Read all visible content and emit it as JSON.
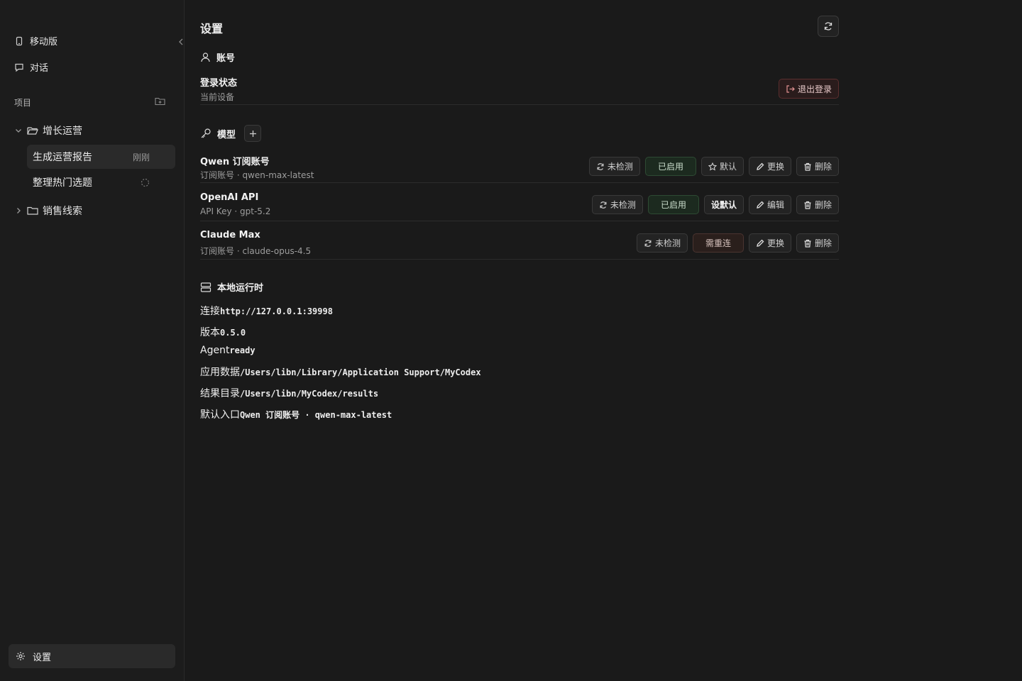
{
  "sidebar": {
    "nav": [
      {
        "label": "移动版",
        "icon": "phone-icon"
      },
      {
        "label": "对话",
        "icon": "chat-icon"
      }
    ],
    "section_label": "项目",
    "projects": [
      {
        "name": "增长运营",
        "expanded": true,
        "threads": [
          {
            "title": "生成运营报告",
            "meta": "刚刚",
            "active": true
          },
          {
            "title": "整理热门选题",
            "meta": "",
            "loading": true
          }
        ]
      },
      {
        "name": "销售线索",
        "expanded": false,
        "threads": []
      }
    ],
    "settings_label": "设置"
  },
  "main": {
    "title": "设置",
    "account": {
      "heading": "账号",
      "login_label": "登录状态",
      "login_sub": "当前设备",
      "logout_label": "退出登录"
    },
    "models": {
      "heading": "模型",
      "items": [
        {
          "name": "Qwen 订阅账号",
          "sub": "订阅账号 · qwen-max-latest",
          "check": "未检测",
          "status": "已启用",
          "default": "默认",
          "action": "更换",
          "delete": "删除"
        },
        {
          "name": "OpenAI API",
          "sub": "API Key · gpt-5.2",
          "check": "未检测",
          "status": "已启用",
          "default": "设默认",
          "action": "编辑",
          "delete": "删除"
        },
        {
          "name": "Claude Max",
          "sub": "订阅账号 · claude-opus-4.5",
          "check": "未检测",
          "status": "需重连",
          "action": "更换",
          "delete": "删除"
        }
      ]
    },
    "runtime": {
      "heading": "本地运行时",
      "rows": [
        {
          "label": "连接",
          "value": "http://127.0.0.1:39998"
        },
        {
          "label": "版本",
          "value": "0.5.0"
        },
        {
          "label": "Agent",
          "value": "ready"
        },
        {
          "label": "应用数据",
          "value": "/Users/libn/Library/Application Support/MyCodex"
        },
        {
          "label": "结果目录",
          "value": "/Users/libn/MyCodex/results"
        },
        {
          "label": "默认入口",
          "value": "Qwen 订阅账号 · qwen-max-latest"
        }
      ]
    }
  }
}
